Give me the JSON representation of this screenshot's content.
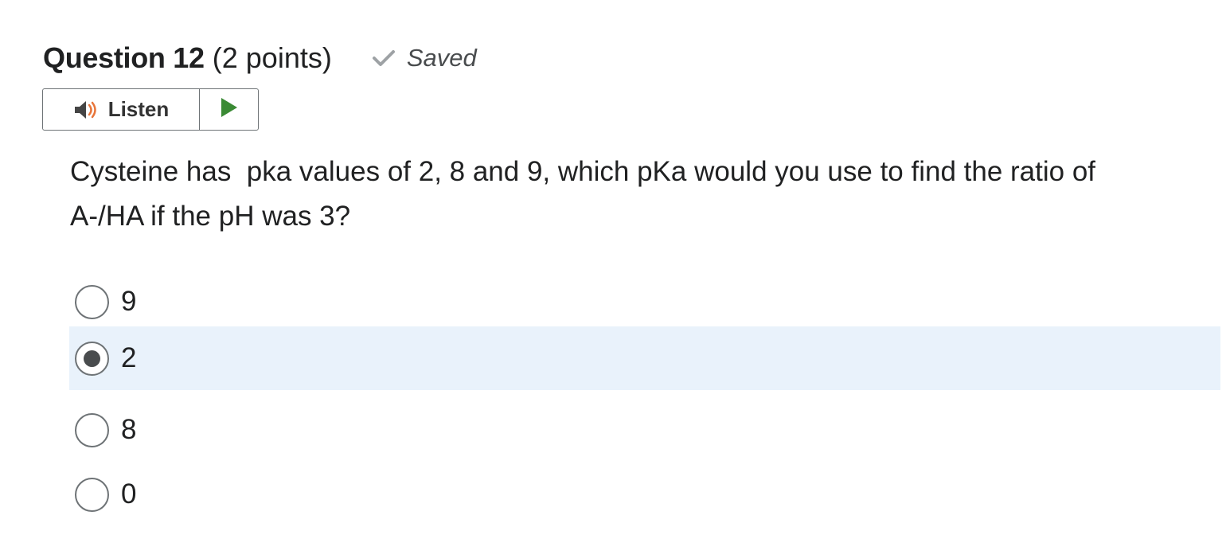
{
  "question": {
    "title": "Question 12",
    "points": "(2 points)",
    "saved_text": "Saved",
    "text": "Cysteine has  pka values of 2, 8 and 9, which pKa would you use to find the ratio of\nA-/HA if the pH was 3?"
  },
  "listen": {
    "label": "Listen"
  },
  "options": [
    {
      "label": "9",
      "selected": false
    },
    {
      "label": "2",
      "selected": true
    },
    {
      "label": "8",
      "selected": false
    },
    {
      "label": "0",
      "selected": false
    }
  ],
  "icons": {
    "saved": "checkmark-icon",
    "listen": "speaker-icon",
    "play": "play-icon"
  },
  "colors": {
    "selected_row_background": "#e9f2fb",
    "play_green": "#3a8a34",
    "speaker_orange": "#e8753a",
    "checkmark_gray": "#9ea2a5"
  }
}
